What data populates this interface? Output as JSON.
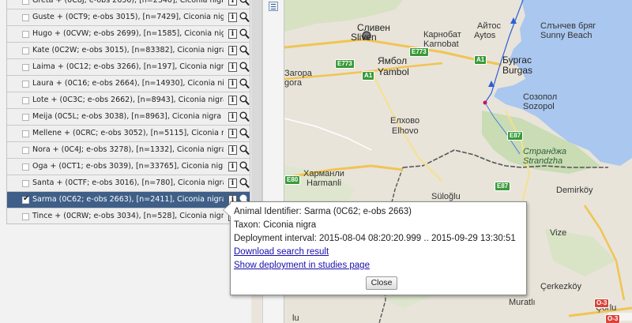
{
  "animal_list": {
    "rows": [
      {
        "label": "Greta + (0C8J; e-obs 2656), [n=2340], Ciconia nigra",
        "selected": false
      },
      {
        "label": "Guste + (0CT9; e-obs 3015), [n=7429], Ciconia nigra",
        "selected": false
      },
      {
        "label": "Hugo + (0CVW; e-obs 2699), [n=1585], Ciconia nigra",
        "selected": false
      },
      {
        "label": "Kate (0C2W; e-obs 3015), [n=83382], Ciconia nigra",
        "selected": false
      },
      {
        "label": "Laima + (0C12; e-obs 3266), [n=197], Ciconia nigra",
        "selected": false
      },
      {
        "label": "Laura + (0C16; e-obs 2664), [n=14930], Ciconia nigra",
        "selected": false
      },
      {
        "label": "Lote + (0C3C; e-obs 2662), [n=8943], Ciconia nigra",
        "selected": false
      },
      {
        "label": "Meija (0C5L; e-obs 3038), [n=8963], Ciconia nigra",
        "selected": false
      },
      {
        "label": "Mellene + (0CRC; e-obs 3052), [n=5115], Ciconia nigr",
        "selected": false
      },
      {
        "label": "Nora + (0C4J; e-obs 3278), [n=1332], Ciconia nigra",
        "selected": false
      },
      {
        "label": "Oga + (0CT1; e-obs 3039), [n=33765], Ciconia nigra",
        "selected": false
      },
      {
        "label": "Santa + (0CTF; e-obs 3016), [n=780], Ciconia nigra",
        "selected": false
      },
      {
        "label": "Sarma (0C62; e-obs 2663), [n=2411], Ciconia nigra",
        "selected": true
      },
      {
        "label": "Tince + (0CRW; e-obs 3034), [n=528], Ciconia nigra",
        "selected": false
      }
    ],
    "info_icon_glyph": "i",
    "selected_color": "#3f5f88"
  },
  "map": {
    "labels": {
      "sliven": "Сливен",
      "sliven_latin": "Sliven",
      "aytos": "Айтос",
      "aytos_latin": "Aytos",
      "karnobat": "Карнобат",
      "karnobat_latin": "Karnobat",
      "sunny_beach": "Слънчев бряг",
      "sunny_beach_latin": "Sunny Beach",
      "burgas": "Бургас",
      "burgas_latin": "Burgas",
      "yambol": "Ямбол",
      "yambol_latin": "Yambol",
      "zagora": "Загора",
      "zagora_latin": "gora",
      "sozopol": "Созопол",
      "sozopol_latin": "Sozopol",
      "elhovo": "Елхово",
      "elhovo_latin": "Elhovo",
      "strandzha": "Странджа",
      "strandzha_latin": "Strandzha",
      "harmanli": "Харманли",
      "harmanli_latin": "Harmanli",
      "demirkoy": "Demirköy",
      "suloglu": "Süloğlu",
      "vize": "Vize",
      "cerkezkoy": "Çerkezköy",
      "muratli": "Muratlı",
      "corlu": "Çorlu",
      "lu": "lu"
    },
    "road_shields": {
      "e773_left": "E773",
      "e773_right": "E773",
      "a1_left": "A1",
      "a1_right": "A1",
      "e87_top": "E87",
      "e87_bottom": "E87",
      "e80": "E80",
      "o3_a": "O-3",
      "o3_b": "O-3"
    },
    "track_color": "#2a5fd8"
  },
  "popup": {
    "animal_identifier": "Animal Identifier: Sarma (0C62; e-obs 2663)",
    "taxon": "Taxon: Ciconia nigra",
    "deployment_interval": "Deployment interval: 2015-08-04 08:20:20.999 .. 2015-09-29 13:30:51",
    "download_link": "Download search result",
    "studies_link": "Show deployment in studies page",
    "close_label": "Close"
  }
}
